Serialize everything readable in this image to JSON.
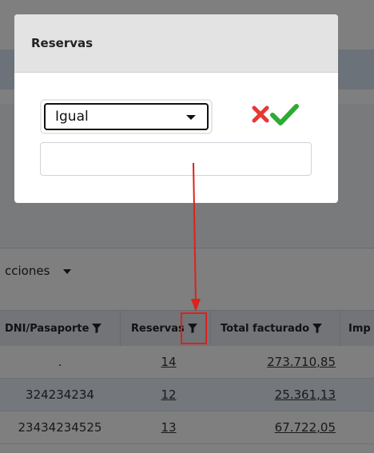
{
  "modal": {
    "title": "Reservas",
    "operator": {
      "selected": "Igual"
    },
    "value_input": {
      "value": "",
      "placeholder": ""
    },
    "cancel_icon": "x-icon",
    "confirm_icon": "check-icon"
  },
  "toolbar": {
    "actions_label": "cciones"
  },
  "table": {
    "headers": [
      {
        "label": "DNI/Pasaporte",
        "filter_icon": "filter-icon"
      },
      {
        "label": "Reservas",
        "filter_icon": "filter-icon"
      },
      {
        "label": "Total facturado",
        "filter_icon": "filter-icon"
      },
      {
        "label": "Imp"
      }
    ],
    "rows": [
      {
        "dni": ".",
        "reservas": "14",
        "total": "273.710,85"
      },
      {
        "dni": "324234234",
        "reservas": "12",
        "total": "25.361,13"
      },
      {
        "dni": "23434234525",
        "reservas": "13",
        "total": "67.722,05"
      }
    ]
  },
  "colors": {
    "annotation": "#e0201b",
    "cancel": "#e53935",
    "confirm": "#2eaa35",
    "overlay": "rgba(0,0,0,0.5)"
  }
}
